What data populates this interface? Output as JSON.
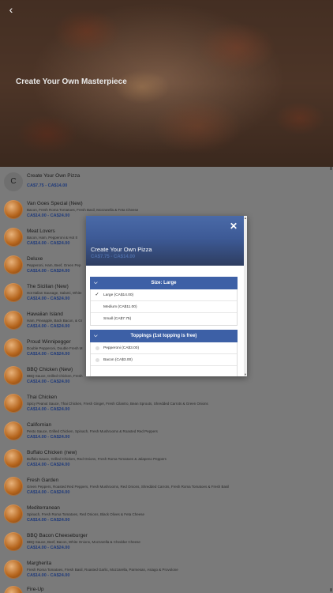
{
  "hero": {
    "back_icon": "chevron-left-icon",
    "title": "Create Your Own Masterpiece"
  },
  "list": {
    "first_item": {
      "letter": "C",
      "name": "Create Your Own Pizza",
      "price": "CA$7.75 - CA$14.00"
    },
    "items": [
      {
        "name": "Van Goes Special (New)",
        "desc": "Bacon, Fresh Roma Tomatoes, Fresh Basil, Mozzarella & Feta Cheese",
        "price": "CA$14.00 - CA$24.00"
      },
      {
        "name": "Meat Lovers",
        "desc": "Bacon, Ham, Pepperoni & Hot It",
        "price": "CA$14.00 - CA$24.00"
      },
      {
        "name": "Deluxe",
        "desc": "Pepperoni, Ham, Beef, Green Pep",
        "price": "CA$14.00 - CA$24.00"
      },
      {
        "name": "The Sicilian (New)",
        "desc": "Hot Italian Sausage, Salami, White",
        "price": "CA$14.00 - CA$24.00"
      },
      {
        "name": "Hawaiian Island",
        "desc": "Ham, Pineapple, Back Bacon, & Gr",
        "price": "CA$14.00 - CA$24.00"
      },
      {
        "name": "Proud Winnipegger",
        "desc": "Double Pepperoni, Double Fresh M",
        "price": "CA$14.00 - CA$24.00"
      },
      {
        "name": "BBQ Chicken (New)",
        "desc": "BBQ Sauce, Grilled Chicken, Fresh",
        "price": "CA$14.00 - CA$24.00"
      },
      {
        "name": "Thai Chicken",
        "desc": "Spicy Peanut Sauce, Thai Chicken, Fresh Ginger, Fresh Cilantro, Bean Sprouts, Shredded Carrots & Green Onions",
        "price": "CA$14.00 - CA$24.00"
      },
      {
        "name": "Californian",
        "desc": "Pesto Sauce, Grilled Chicken, Spinach, Fresh Mushrooms & Roasted Red Peppers",
        "price": "CA$14.00 - CA$24.00"
      },
      {
        "name": "Buffalo Chicken (new)",
        "desc": "Buffalo Sauce, Grilled Chicken, Red Onions, Fresh Roma Tomatoes & Jalapeno Peppers",
        "price": "CA$14.00 - CA$24.00"
      },
      {
        "name": "Fresh Garden",
        "desc": "Green Peppers, Roasted Red Peppers, Fresh Mushrooms, Red Onions, Shredded Carrots, Fresh Roma Tomatoes & Fresh Basil",
        "price": "CA$14.00 - CA$24.00"
      },
      {
        "name": "Mediterranean",
        "desc": "Spinach, Fresh Roma Tomatoes, Red Onions, Black Olives & Feta Cheese",
        "price": "CA$14.00 - CA$24.00"
      },
      {
        "name": "BBQ Bacon Cheeseburger",
        "desc": "BBQ Sauce, Beef, Bacon, White Onions, Mozzarella & Cheddar Cheese",
        "price": "CA$14.00 - CA$24.00"
      },
      {
        "name": "Margherita",
        "desc": "Fresh Roma Tomatoes, Fresh Basil, Roasted Garlic, Mozzarella, Parmesan, Asiago & Provolone",
        "price": "CA$14.00 - CA$24.00"
      },
      {
        "name": "Fire-Up",
        "desc": "",
        "price": ""
      }
    ]
  },
  "modal": {
    "close_icon": "close-icon",
    "title": "Create Your Own Pizza",
    "price": "CA$7.75 - CA$14.00",
    "size_section": {
      "label": "Size: Large",
      "options": [
        {
          "label": "Large (CA$14.00)",
          "selected": true
        },
        {
          "label": "Medium (CA$11.00)",
          "selected": false
        },
        {
          "label": "Small (CA$7.75)",
          "selected": false
        }
      ]
    },
    "toppings_section": {
      "label": "Toppings (1st topping is free)",
      "options": [
        {
          "label": "Pepperoni (CA$3.00)"
        },
        {
          "label": "Bacon (CA$3.00)"
        }
      ]
    }
  },
  "colors": {
    "accent_blue": "#3d60a6",
    "price_blue": "#1f3a7a"
  }
}
